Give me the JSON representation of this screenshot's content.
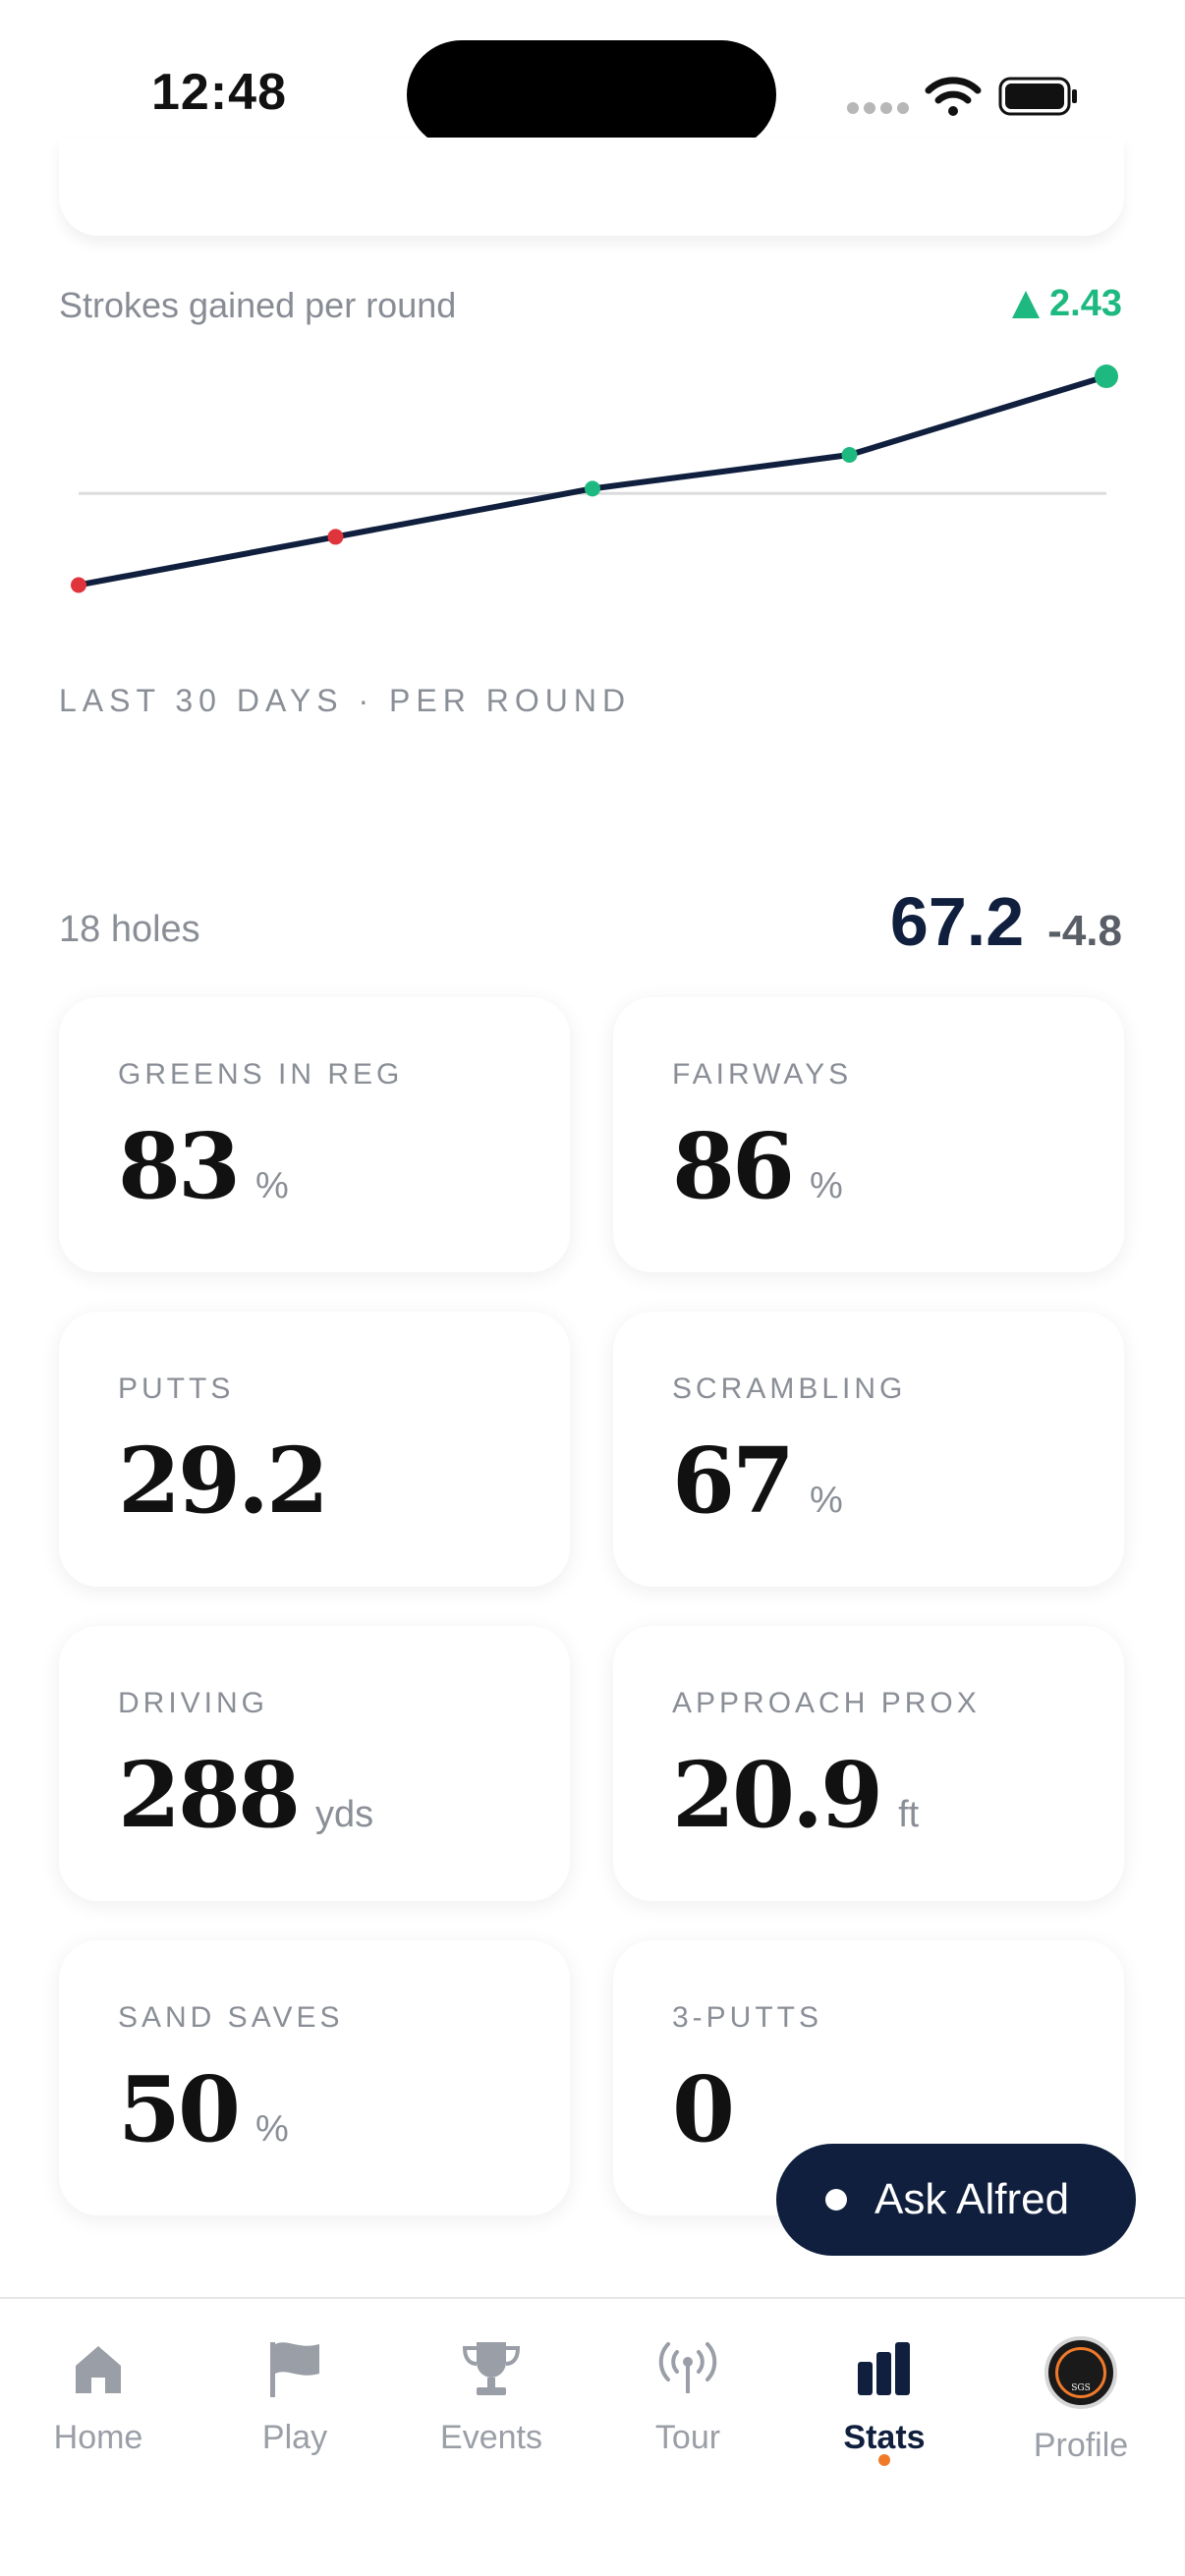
{
  "status_bar": {
    "time": "12:48"
  },
  "strokes_gained": {
    "label": "Strokes gained per round",
    "value": "2.43",
    "color_up": "#1eb980"
  },
  "chart_data": {
    "type": "line",
    "x": [
      1,
      2,
      3,
      4,
      5
    ],
    "values": [
      -1.9,
      -0.9,
      0.1,
      0.8,
      2.43
    ],
    "baseline": 0,
    "point_colors": [
      "#e0343c",
      "#e0343c",
      "#1eb980",
      "#1eb980",
      "#1eb980"
    ],
    "line_color": "#0f1f3d",
    "ylim": [
      -2.4,
      2.9
    ],
    "grid": false
  },
  "range_label": "LAST 30 DAYS · PER ROUND",
  "summary": {
    "holes_label": "18 holes",
    "score": "67.2",
    "diff": "-4.8"
  },
  "stats": [
    {
      "label": "GREENS IN REG",
      "value": "83",
      "unit": "%"
    },
    {
      "label": "FAIRWAYS",
      "value": "86",
      "unit": "%"
    },
    {
      "label": "PUTTS",
      "value": "29.2",
      "unit": ""
    },
    {
      "label": "SCRAMBLING",
      "value": "67",
      "unit": "%"
    },
    {
      "label": "DRIVING",
      "value": "288",
      "unit": "yds"
    },
    {
      "label": "APPROACH PROX",
      "value": "20.9",
      "unit": "ft"
    },
    {
      "label": "SAND SAVES",
      "value": "50",
      "unit": "%"
    },
    {
      "label": "3-PUTTS",
      "value": "0",
      "unit": ""
    }
  ],
  "ask_button": {
    "label": "Ask Alfred"
  },
  "tabs": [
    {
      "label": "Home",
      "icon": "home-icon"
    },
    {
      "label": "Play",
      "icon": "flag-icon"
    },
    {
      "label": "Events",
      "icon": "trophy-icon"
    },
    {
      "label": "Tour",
      "icon": "broadcast-icon"
    },
    {
      "label": "Stats",
      "icon": "bar-chart-icon",
      "active": true
    },
    {
      "label": "Profile",
      "icon": "avatar-icon"
    }
  ],
  "avatar_text": "SGS",
  "colors": {
    "navy": "#0f1f3d",
    "green": "#1eb980",
    "red": "#e0343c",
    "orange": "#f07a2a"
  }
}
